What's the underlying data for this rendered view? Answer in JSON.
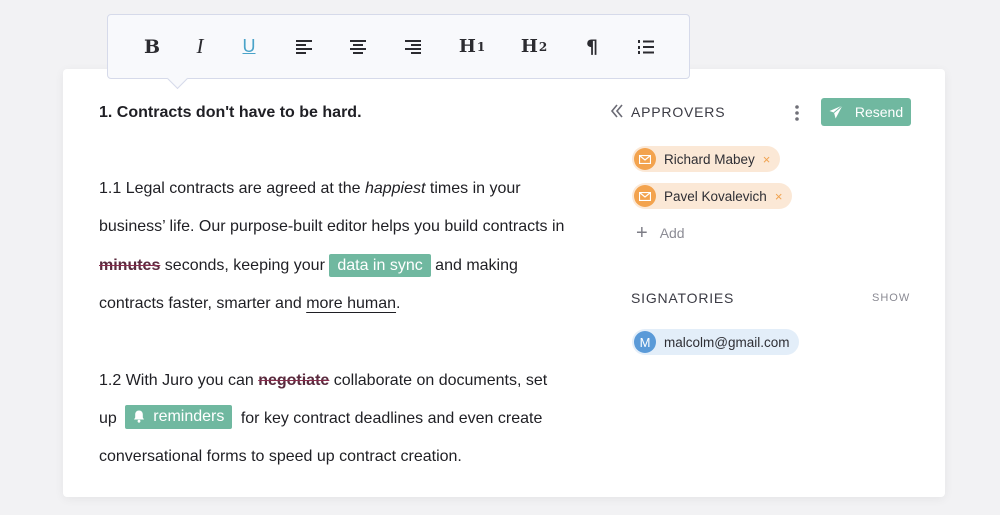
{
  "toolbar": {
    "buttons": [
      {
        "name": "bold",
        "label": "B"
      },
      {
        "name": "italic",
        "label": "I"
      },
      {
        "name": "underline",
        "label": "U"
      },
      {
        "name": "align-left-icon"
      },
      {
        "name": "align-center-icon"
      },
      {
        "name": "align-right-icon"
      },
      {
        "name": "heading-1",
        "label": "H",
        "sup": "1"
      },
      {
        "name": "heading-2",
        "label": "H",
        "sup": "2"
      },
      {
        "name": "pilcrow-icon",
        "label": "¶"
      },
      {
        "name": "numbered-list-icon"
      }
    ]
  },
  "document": {
    "heading": "1. Contracts don't have to be hard.",
    "para1": {
      "t1": "1.1 Legal contracts are agreed at the ",
      "emph": "happiest",
      "t2": " times in your business’ life. Our purpose-built editor helps you build contracts in ",
      "struck": "minutes",
      "t3": " seconds, keeping your ",
      "tag": "data in sync",
      "t4": " and making contracts faster, smarter and ",
      "link": "more human",
      "t5": "."
    },
    "para2": {
      "t1": "1.2 With Juro you can ",
      "struck": "negotiate",
      "t2": " collaborate on documents, set up ",
      "tag": "reminders",
      "t3": " for key contract deadlines and even create conversational forms to speed up contract creation."
    }
  },
  "sidebar": {
    "approvers_title": "APPROVERS",
    "resend_label": "Resend",
    "approvers": [
      {
        "name": "Richard Mabey",
        "remove": "×"
      },
      {
        "name": "Pavel Kovalevich",
        "remove": "×"
      }
    ],
    "add_label": "Add",
    "add_plus": "+",
    "signatories_title": "SIGNATORIES",
    "show_label": "SHOW",
    "signatories": [
      {
        "initial": "M",
        "email": "malcolm@gmail.com"
      }
    ]
  },
  "colors": {
    "accent_green": "#70b8a0",
    "approver_chip": "#fbe8d6",
    "approver_icon": "#f3a34e",
    "signer_chip": "#e3eef9",
    "signer_icon": "#5a9ad8"
  }
}
